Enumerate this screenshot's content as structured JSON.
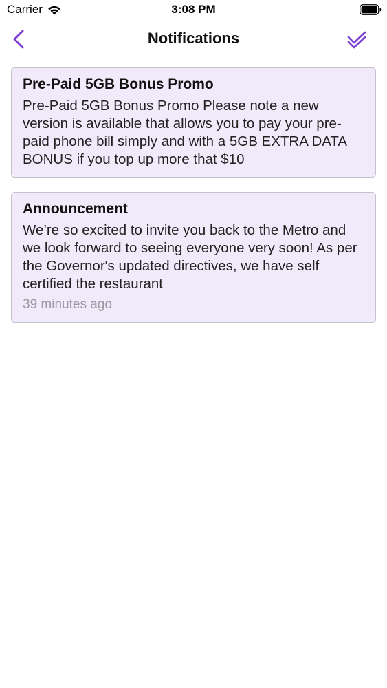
{
  "status_bar": {
    "carrier": "Carrier",
    "time": "3:08 PM",
    "wifi_icon": "wifi-icon",
    "battery_icon": "battery-icon"
  },
  "nav": {
    "title": "Notifications",
    "back_icon": "chevron-left-icon",
    "mark_all_icon": "double-check-icon",
    "accent_color": "#7c3fd1"
  },
  "notifications": [
    {
      "title": "Pre-Paid 5GB Bonus Promo",
      "body": "Pre-Paid 5GB Bonus Promo Please note a new version is available that allows you to pay your pre-paid phone bill simply and with a 5GB EXTRA DATA BONUS if you top up more that $10",
      "time": ""
    },
    {
      "title": "Announcement",
      "body": "We’re so excited to invite you back to the Metro and we look forward to seeing everyone very soon! As per the Governor's updated directives, we have self certified the restaurant",
      "time": "39 minutes ago"
    }
  ],
  "colors": {
    "card_background": "#f1eafa",
    "card_border": "#c6c2cc",
    "timestamp": "#9a98a0"
  }
}
